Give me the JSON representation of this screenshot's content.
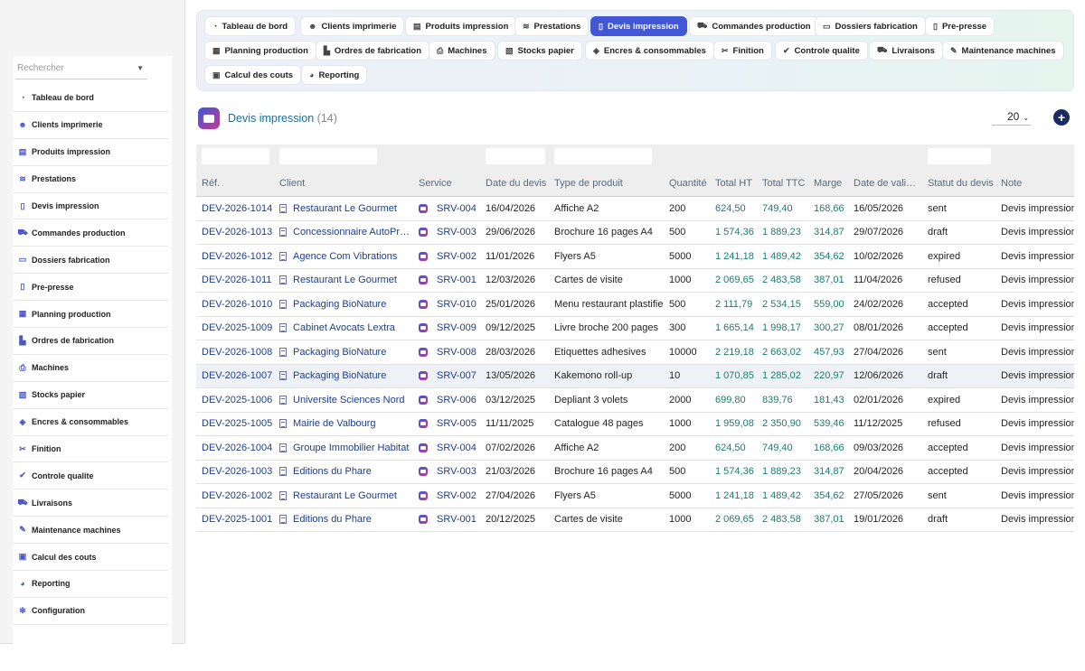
{
  "sidebar": {
    "search_placeholder": "Rechercher",
    "items": [
      {
        "label": "Tableau de bord",
        "icon": "dashboard-icon",
        "glyph": "◔"
      },
      {
        "label": "Clients imprimerie",
        "icon": "users-icon",
        "glyph": "☻"
      },
      {
        "label": "Produits impression",
        "icon": "product-icon",
        "glyph": "▤"
      },
      {
        "label": "Prestations",
        "icon": "layers-icon",
        "glyph": "≋"
      },
      {
        "label": "Devis impression",
        "icon": "file-icon",
        "glyph": "▯"
      },
      {
        "label": "Commandes production",
        "icon": "cart-icon",
        "glyph": "⛟"
      },
      {
        "label": "Dossiers fabrication",
        "icon": "folder-icon",
        "glyph": "▭"
      },
      {
        "label": "Pre-presse",
        "icon": "document-icon",
        "glyph": "▯"
      },
      {
        "label": "Planning production",
        "icon": "calendar-icon",
        "glyph": "▦"
      },
      {
        "label": "Ordres de fabrication",
        "icon": "factory-icon",
        "glyph": "▙"
      },
      {
        "label": "Machines",
        "icon": "printer-icon",
        "glyph": "⎙"
      },
      {
        "label": "Stocks papier",
        "icon": "stock-icon",
        "glyph": "▧"
      },
      {
        "label": "Encres & consommables",
        "icon": "ink-icon",
        "glyph": "◈"
      },
      {
        "label": "Finition",
        "icon": "scissors-icon",
        "glyph": "✂"
      },
      {
        "label": "Controle qualite",
        "icon": "check-icon",
        "glyph": "✔"
      },
      {
        "label": "Livraisons",
        "icon": "truck-icon",
        "glyph": "⛟"
      },
      {
        "label": "Maintenance machines",
        "icon": "wrench-icon",
        "glyph": "✎"
      },
      {
        "label": "Calcul des couts",
        "icon": "calculator-icon",
        "glyph": "▣"
      },
      {
        "label": "Reporting",
        "icon": "chart-icon",
        "glyph": "◕"
      },
      {
        "label": "Configuration",
        "icon": "gear-icon",
        "glyph": "✻"
      }
    ]
  },
  "tabs": [
    {
      "label": "Tableau de bord",
      "glyph": "◔",
      "icon": "dashboard-icon",
      "active": false
    },
    {
      "label": "Clients imprimerie",
      "glyph": "☻",
      "icon": "users-icon",
      "active": false
    },
    {
      "label": "Produits impression",
      "glyph": "▤",
      "icon": "product-icon",
      "active": false
    },
    {
      "label": "Prestations",
      "glyph": "≋",
      "icon": "layers-icon",
      "active": false
    },
    {
      "label": "Devis impression",
      "glyph": "▯",
      "icon": "file-icon",
      "active": true
    },
    {
      "label": "Commandes production",
      "glyph": "⛟",
      "icon": "cart-icon",
      "active": false
    },
    {
      "label": "Dossiers fabrication",
      "glyph": "▭",
      "icon": "folder-icon",
      "active": false
    },
    {
      "label": "Pre-presse",
      "glyph": "▯",
      "icon": "document-icon",
      "active": false
    },
    {
      "label": "Planning production",
      "glyph": "▦",
      "icon": "calendar-icon",
      "active": false
    },
    {
      "label": "Ordres de fabrication",
      "glyph": "▙",
      "icon": "factory-icon",
      "active": false
    },
    {
      "label": "Machines",
      "glyph": "⎙",
      "icon": "printer-icon",
      "active": false
    },
    {
      "label": "Stocks papier",
      "glyph": "▧",
      "icon": "stock-icon",
      "active": false
    },
    {
      "label": "Encres & consommables",
      "glyph": "◈",
      "icon": "ink-icon",
      "active": false
    },
    {
      "label": "Finition",
      "glyph": "✂",
      "icon": "scissors-icon",
      "active": false
    },
    {
      "label": "Controle qualite",
      "glyph": "✔",
      "icon": "check-icon",
      "active": false
    },
    {
      "label": "Livraisons",
      "glyph": "⛟",
      "icon": "truck-icon",
      "active": false
    },
    {
      "label": "Maintenance machines",
      "glyph": "✎",
      "icon": "wrench-icon",
      "active": false
    },
    {
      "label": "Calcul des couts",
      "glyph": "▣",
      "icon": "calculator-icon",
      "active": false
    },
    {
      "label": "Reporting",
      "glyph": "◕",
      "icon": "chart-icon",
      "active": false
    }
  ],
  "header": {
    "title": "Devis impression",
    "count": "(14)",
    "page_size": "20",
    "add_icon": "plus-circle-icon"
  },
  "table": {
    "columns": [
      "Réf.",
      "Client",
      "Service",
      "Date du devis",
      "Type de produit",
      "Quantité",
      "Total HT",
      "Total TTC",
      "Marge",
      "Date de vali…",
      "Statut du devis",
      "Note"
    ],
    "rows": [
      [
        "DEV-2026-1014",
        "Restaurant Le Gourmet",
        "SRV-004",
        "16/04/2026",
        "Affiche A2",
        "200",
        "624,50",
        "749,40",
        "168,66",
        "16/05/2026",
        "sent",
        "Devis impression"
      ],
      [
        "DEV-2026-1013",
        "Concessionnaire AutoPr…",
        "SRV-003",
        "29/06/2026",
        "Brochure 16 pages A4",
        "500",
        "1 574,36",
        "1 889,23",
        "314,87",
        "29/07/2026",
        "draft",
        "Devis impression"
      ],
      [
        "DEV-2026-1012",
        "Agence Com Vibrations",
        "SRV-002",
        "11/01/2026",
        "Flyers A5",
        "5000",
        "1 241,18",
        "1 489,42",
        "354,62",
        "10/02/2026",
        "expired",
        "Devis impression"
      ],
      [
        "DEV-2026-1011",
        "Restaurant Le Gourmet",
        "SRV-001",
        "12/03/2026",
        "Cartes de visite",
        "1000",
        "2 069,65",
        "2 483,58",
        "387,01",
        "11/04/2026",
        "refused",
        "Devis impression"
      ],
      [
        "DEV-2026-1010",
        "Packaging BioNature",
        "SRV-010",
        "25/01/2026",
        "Menu restaurant plastifie",
        "500",
        "2 111,79",
        "2 534,15",
        "559,00",
        "24/02/2026",
        "accepted",
        "Devis impression"
      ],
      [
        "DEV-2025-1009",
        "Cabinet Avocats Lextra",
        "SRV-009",
        "09/12/2025",
        "Livre broche 200 pages",
        "300",
        "1 665,14",
        "1 998,17",
        "300,27",
        "08/01/2026",
        "accepted",
        "Devis impression"
      ],
      [
        "DEV-2026-1008",
        "Packaging BioNature",
        "SRV-008",
        "28/03/2026",
        "Etiquettes adhesives",
        "10000",
        "2 219,18",
        "2 663,02",
        "457,93",
        "27/04/2026",
        "sent",
        "Devis impression"
      ],
      [
        "DEV-2026-1007",
        "Packaging BioNature",
        "SRV-007",
        "13/05/2026",
        "Kakemono roll-up",
        "10",
        "1 070,85",
        "1 285,02",
        "220,97",
        "12/06/2026",
        "draft",
        "Devis impression"
      ],
      [
        "DEV-2025-1006",
        "Universite Sciences Nord",
        "SRV-006",
        "03/12/2025",
        "Depliant 3 volets",
        "2000",
        "699,80",
        "839,76",
        "181,43",
        "02/01/2026",
        "expired",
        "Devis impression"
      ],
      [
        "DEV-2025-1005",
        "Mairie de Valbourg",
        "SRV-005",
        "11/11/2025",
        "Catalogue 48 pages",
        "1000",
        "1 959,08",
        "2 350,90",
        "539,46",
        "11/12/2025",
        "refused",
        "Devis impression"
      ],
      [
        "DEV-2026-1004",
        "Groupe Immobilier Habitat",
        "SRV-004",
        "07/02/2026",
        "Affiche A2",
        "200",
        "624,50",
        "749,40",
        "168,66",
        "09/03/2026",
        "accepted",
        "Devis impression"
      ],
      [
        "DEV-2026-1003",
        "Editions du Phare",
        "SRV-003",
        "21/03/2026",
        "Brochure 16 pages A4",
        "500",
        "1 574,36",
        "1 889,23",
        "314,87",
        "20/04/2026",
        "accepted",
        "Devis impression"
      ],
      [
        "DEV-2026-1002",
        "Restaurant Le Gourmet",
        "SRV-002",
        "27/04/2026",
        "Flyers A5",
        "5000",
        "1 241,18",
        "1 489,42",
        "354,62",
        "27/05/2026",
        "sent",
        "Devis impression"
      ],
      [
        "DEV-2025-1001",
        "Editions du Phare",
        "SRV-001",
        "20/12/2025",
        "Cartes de visite",
        "1000",
        "2 069,65",
        "2 483,58",
        "387,01",
        "19/01/2026",
        "draft",
        "Devis impression"
      ]
    ],
    "highlighted_row": 7
  }
}
